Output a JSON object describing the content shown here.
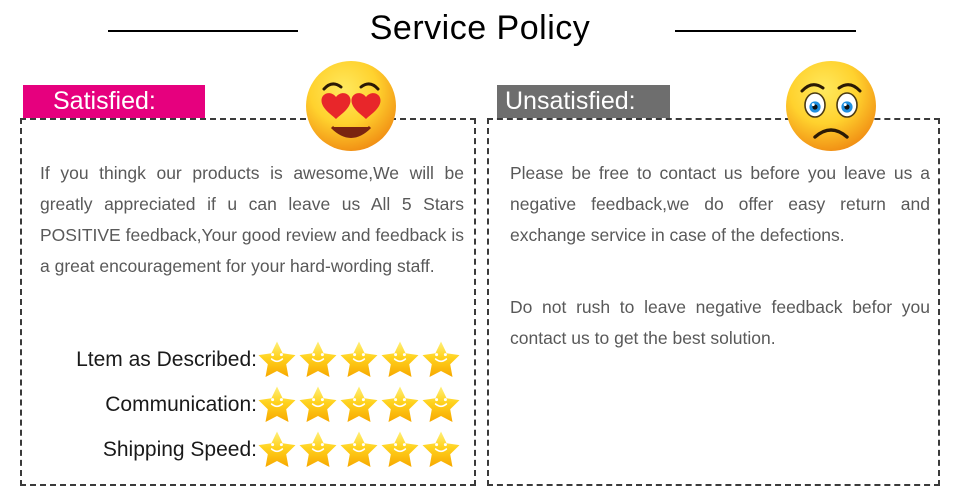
{
  "header": {
    "title": "Service Policy",
    "divider_icon": "horizontal-rule"
  },
  "satisfied": {
    "banner_label": "Satisfied:",
    "banner_color": "#e6007e",
    "emoji": "heart-eyes-face",
    "paragraph": "If you thingk our products is awesome,We will be greatly appreciated if u can leave us All 5 Stars POSITIVE feedback,Your good review and feedback is a great encouragement for your hard-wording staff.",
    "ratings": [
      {
        "label": "Ltem as Described:",
        "stars": 5
      },
      {
        "label": "Communication:",
        "stars": 5
      },
      {
        "label": "Shipping Speed:",
        "stars": 5
      }
    ],
    "star_icon": "smiling-star-icon",
    "star_color": "#fcc10a"
  },
  "unsatisfied": {
    "banner_label": "Unsatisfied:",
    "banner_color": "#6e6e6e",
    "emoji": "worried-face",
    "paragraph_1": "Please be free to contact us before you leave us a negative feedback,we do offer easy return and exchange service in case of the defections.",
    "paragraph_2": "Do not rush to leave negative feedback befor you contact us to get the best solution."
  },
  "colors": {
    "body_text": "#595959",
    "title_text": "#000000",
    "border": "#3a3a3a",
    "background": "#ffffff"
  }
}
